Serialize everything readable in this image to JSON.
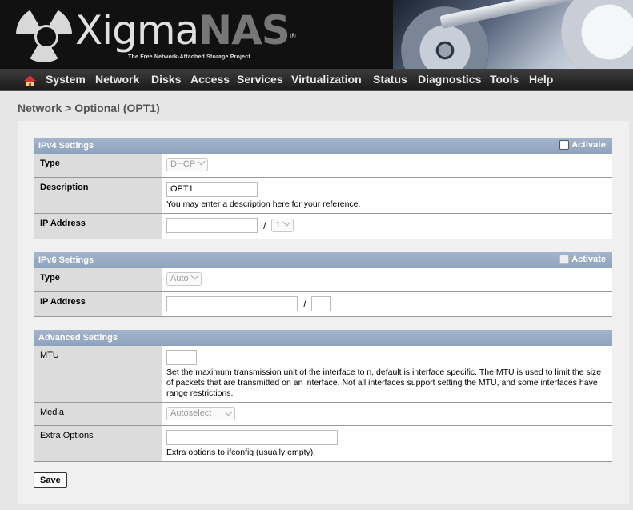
{
  "header": {
    "logo_text_1": "Xigma",
    "logo_text_2": "NAS",
    "trademark": "®",
    "tagline": "The Free Network-Attached Storage Project"
  },
  "nav": {
    "items": [
      "System",
      "Network",
      "Disks",
      "Access",
      "Services",
      "Virtualization",
      "Status",
      "Diagnostics",
      "Tools",
      "Help"
    ]
  },
  "page": {
    "title": "Network > Optional (OPT1)"
  },
  "ipv4": {
    "heading": "IPv4 Settings",
    "activate_label": "Activate",
    "activate_checked": false,
    "type_label": "Type",
    "type_value": "DHCP",
    "description_label": "Description",
    "description_value": "OPT1",
    "description_note": "You may enter a description here for your reference.",
    "ip_label": "IP Address",
    "ip_value": "",
    "prefix_value": "1"
  },
  "ipv6": {
    "heading": "IPv6 Settings",
    "activate_label": "Activate",
    "activate_checked": false,
    "type_label": "Type",
    "type_value": "Auto",
    "ip_label": "IP Address",
    "ip_value": "",
    "prefix_value": ""
  },
  "advanced": {
    "heading": "Advanced Settings",
    "mtu_label": "MTU",
    "mtu_value": "",
    "mtu_note": "Set the maximum transmission unit of the interface to n, default is interface specific. The MTU is used to limit the size of packets that are transmitted on an interface. Not all interfaces support setting the MTU, and some interfaces have range restrictions.",
    "media_label": "Media",
    "media_value": "Autoselect",
    "extra_label": "Extra Options",
    "extra_value": "",
    "extra_note": "Extra options to ifconfig (usually empty)."
  },
  "buttons": {
    "save": "Save"
  }
}
